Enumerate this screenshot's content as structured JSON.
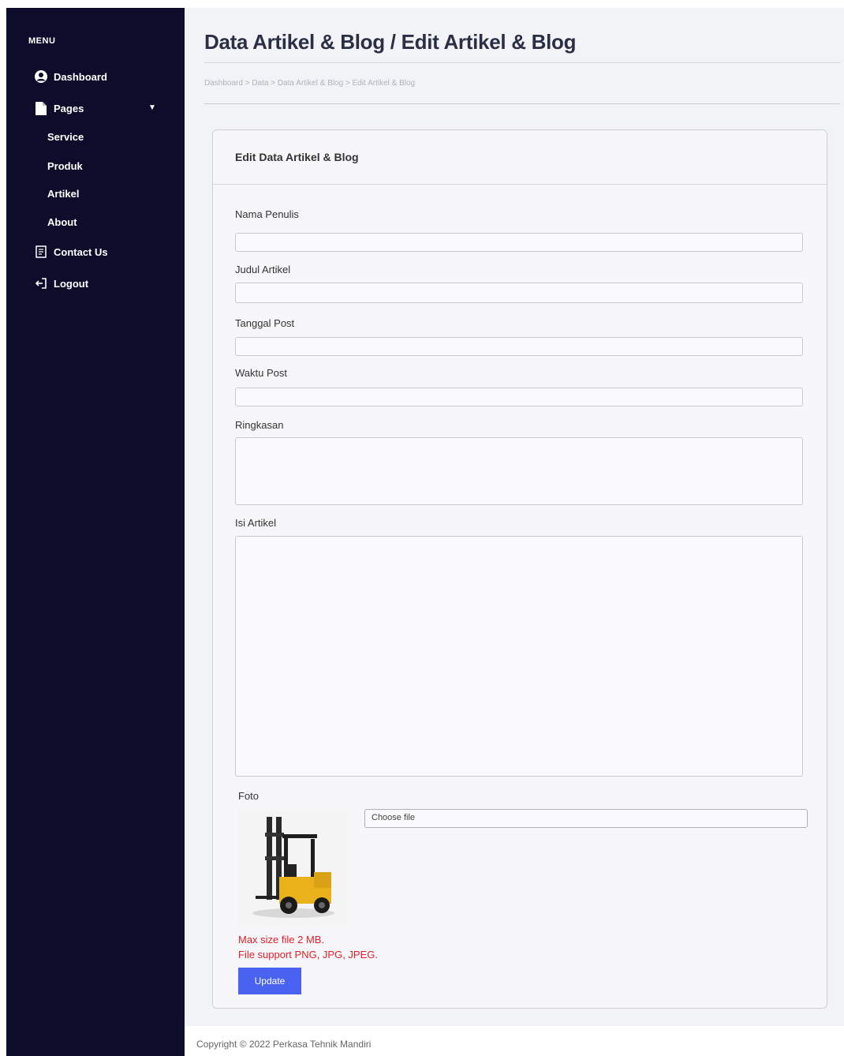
{
  "sidebar": {
    "menu_title": "MENU",
    "items": [
      {
        "label": "Dashboard",
        "icon": "user-circle-icon"
      },
      {
        "label": "Pages",
        "icon": "file-icon"
      },
      {
        "label": "Contact Us",
        "icon": "contact-form-icon"
      },
      {
        "label": "Logout",
        "icon": "logout-icon"
      }
    ],
    "sub_items": [
      "Service",
      "Produk",
      "Artikel",
      "About"
    ]
  },
  "header": {
    "title": "Data Artikel & Blog / Edit Artikel & Blog",
    "breadcrumb": "Dashboard > Data > Data Artikel & Blog > Edit Artikel & Blog"
  },
  "form": {
    "card_title": "Edit Data Artikel & Blog",
    "fields": {
      "nama_penulis": {
        "label": "Nama Penulis",
        "value": ""
      },
      "judul_artikel": {
        "label": "Judul Artikel",
        "value": ""
      },
      "tanggal_post": {
        "label": "Tanggal Post",
        "value": ""
      },
      "waktu_post": {
        "label": "Waktu Post",
        "value": ""
      },
      "ringkasan": {
        "label": "Ringkasan",
        "value": ""
      },
      "isi_artikel": {
        "label": "Isi Artikel",
        "value": ""
      }
    },
    "foto_label": "Foto",
    "file_button": "Choose file",
    "note_size": "Max size file 2 MB.",
    "note_types": "File support PNG, JPG, JPEG.",
    "update_label": "Update"
  },
  "footer": {
    "copyright": "Copyright © 2022 Perkasa Tehnik Mandiri"
  },
  "colors": {
    "sidebar_bg": "#0d0d2b",
    "accent_button": "#4a62f0",
    "note_text": "#e0202a"
  }
}
